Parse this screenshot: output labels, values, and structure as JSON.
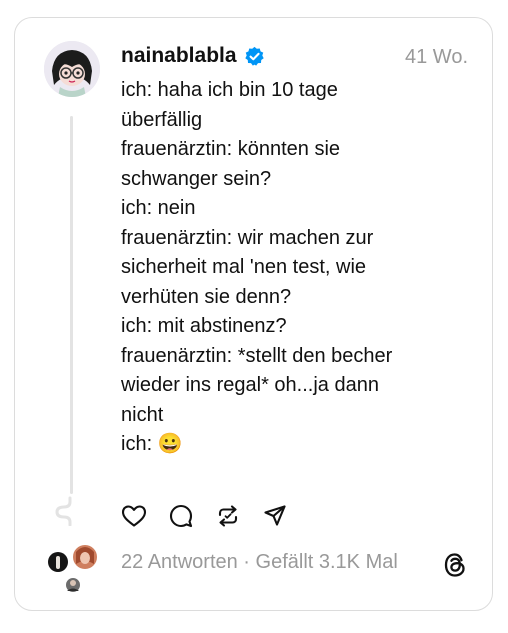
{
  "post": {
    "username": "nainablabla",
    "time": "41 Wo.",
    "lines": [
      "ich: haha ich bin 10 tage",
      "überfällig",
      "frauenärztin: könnten sie",
      "schwanger sein?",
      "ich: nein",
      "frauenärztin: wir machen zur",
      "sicherheit mal 'nen test, wie",
      "verhüten sie denn?",
      "ich: mit abstinenz?",
      "frauenärztin: *stellt den becher",
      "wieder ins regal* oh...ja dann",
      "nicht",
      "ich: 😀"
    ]
  },
  "stats": {
    "text": "22 Antworten · Gefällt 3.1K Mal"
  },
  "icons": {
    "verified": "verified-badge-icon",
    "like": "heart-icon",
    "reply": "comment-icon",
    "repost": "repost-icon",
    "share": "send-icon",
    "brand": "threads-logo-icon"
  },
  "colors": {
    "verified": "#0095f6",
    "muted": "#999999",
    "text": "#111111"
  }
}
